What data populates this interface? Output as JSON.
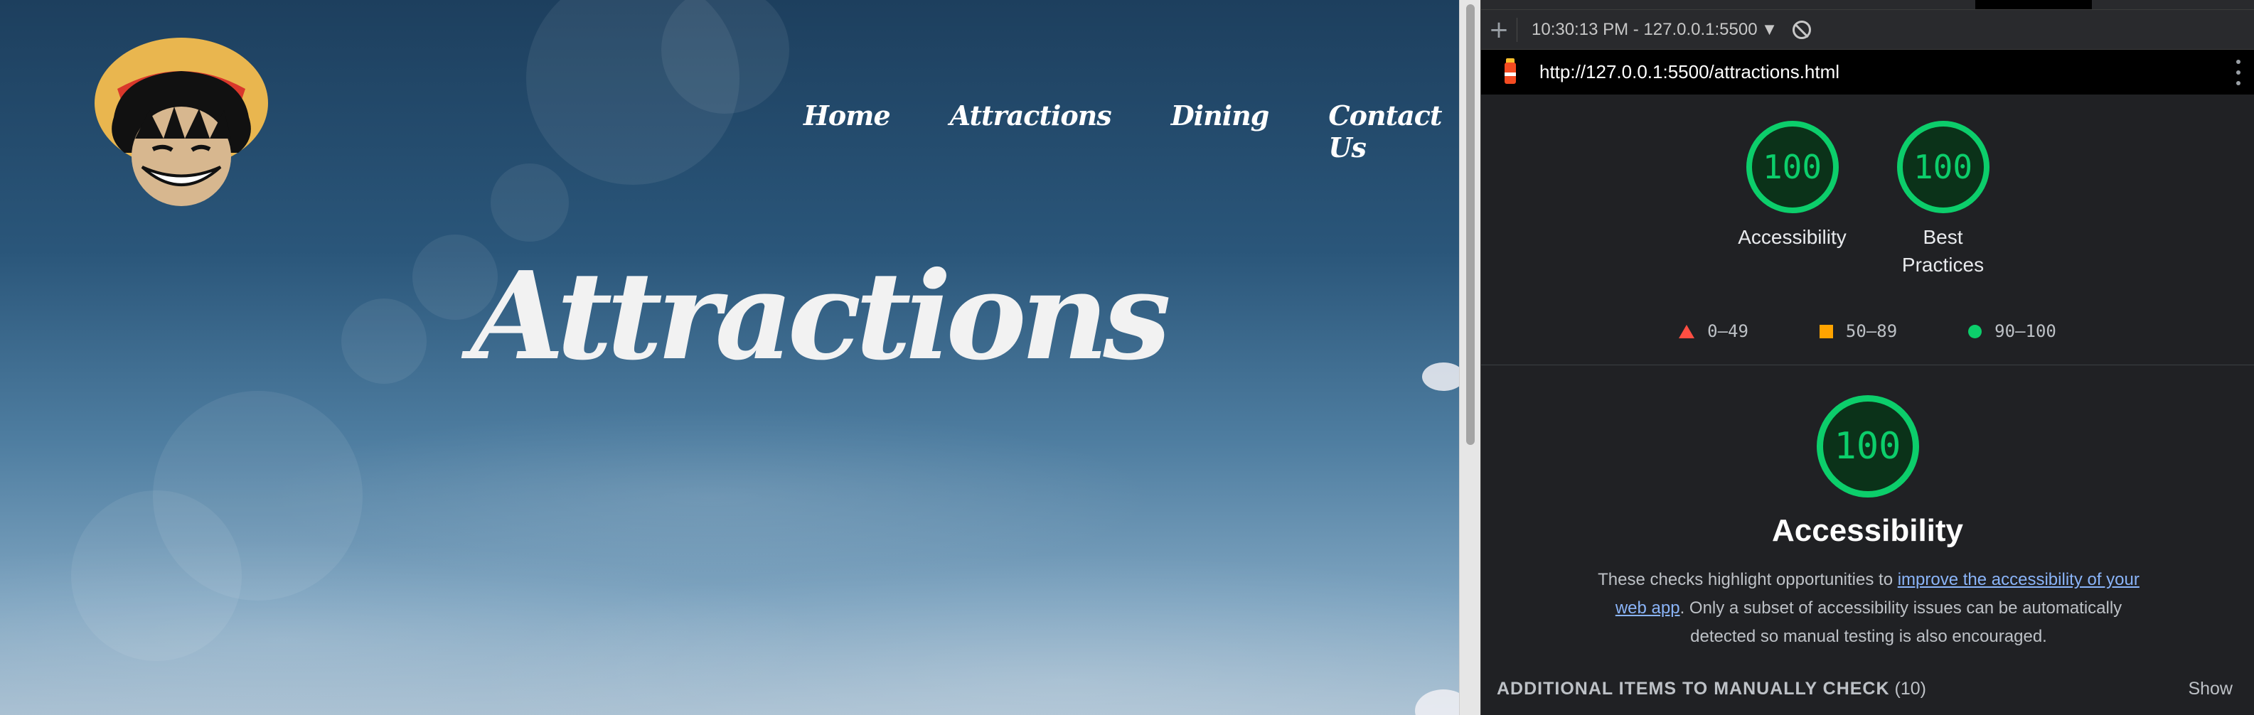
{
  "site": {
    "logo_icon": "straw-hat-pirate-logo",
    "nav": {
      "home": "Home",
      "attractions": "Attractions",
      "dining": "Dining",
      "contact": "Contact Us"
    },
    "hero_title": "Attractions"
  },
  "devtools": {
    "toolbar": {
      "add_icon": "plus-icon",
      "report_select": "10:30:13 PM - 127.0.0.1:5500",
      "clear_icon": "block-icon"
    },
    "url": "http://127.0.0.1:5500/attractions.html",
    "scores": [
      {
        "value": "100",
        "label": "Accessibility"
      },
      {
        "value": "100",
        "label": "Best Practices"
      }
    ],
    "legend": {
      "fail": "0–49",
      "average": "50–89",
      "pass": "90–100"
    },
    "section": {
      "score": "100",
      "title": "Accessibility",
      "desc_before": "These checks highlight opportunities to ",
      "desc_link": "improve the accessibility of your web app",
      "desc_after": ". Only a subset of accessibility issues can be automatically detected so manual testing is also encouraged."
    },
    "manual_check": {
      "title": "ADDITIONAL ITEMS TO MANUALLY CHECK",
      "count": "(10)",
      "show": "Show"
    },
    "colors": {
      "pass": "#0cce6b",
      "average": "#ffa400",
      "fail": "#ff4e42",
      "link": "#8ab4f8"
    }
  }
}
